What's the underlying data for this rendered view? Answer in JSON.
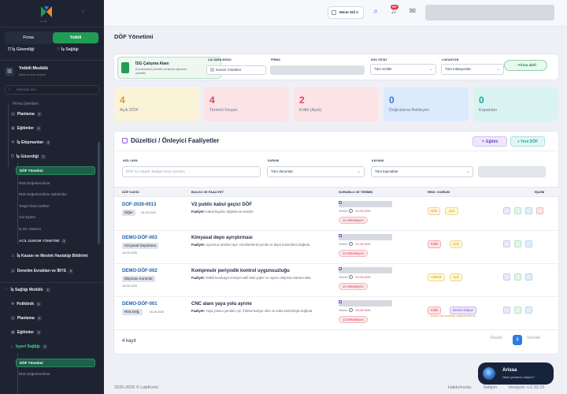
{
  "sidebar": {
    "logo_sub": "by iSG",
    "toggle": {
      "firma": "Firma",
      "yetkili": "Yetkili"
    },
    "switch": {
      "isg": "İş Güvenliği",
      "saglik": "İş Sağlığı"
    },
    "module": {
      "title": "Yetkili Modülü",
      "subtitle": "İşletme hızlı erişimi"
    },
    "search_placeholder": "Menüde ara...",
    "items": [
      {
        "label": "Firma İşlemleri",
        "count": ""
      },
      {
        "label": "Planlama",
        "count": "4"
      },
      {
        "label": "Eğitimler",
        "count": "4"
      },
      {
        "label": "İş Ekipmanları",
        "count": "4"
      },
      {
        "label": "İş Güvenliği",
        "count": "7"
      },
      {
        "label": "DÖF Yönetimi"
      },
      {
        "label": "Risk Değerlendirme"
      },
      {
        "label": "Risk Değerlendirme Şablonları"
      },
      {
        "label": "Tespit Öneri Defteri"
      },
      {
        "label": "Acil Eylem"
      },
      {
        "label": "İş İzin Sistemi"
      },
      {
        "label": "ACİL DURUM YÖNETİMİ",
        "count": "3"
      },
      {
        "label": "İş Kazası ve Meslek Hastalığı Bildirimi",
        "count": ""
      },
      {
        "label": "Denetim Evrakları ve İBYS",
        "count": "3"
      },
      {
        "label": "İş Sağlığı Modülü",
        "count": "4"
      },
      {
        "label": "Poliklinik",
        "count": "4"
      },
      {
        "label": "Planlama",
        "count": "4"
      },
      {
        "label": "Eğitimler",
        "count": "4"
      },
      {
        "label": "İşyeri Sağlığı",
        "count": "4"
      },
      {
        "label": "DÖF Yönetimi"
      },
      {
        "label": "Risk Değerlendirme"
      }
    ]
  },
  "header": {
    "company": "Menü Stil 2",
    "notif_badge": "99+"
  },
  "page": {
    "title": "DÖF Yönetimi"
  },
  "context": {
    "area_title": "İSG Çalışma Alanı",
    "area_desc": "Kurum/şirket yönetim verilerine işlemleri yönelttir",
    "mode_label": "ÇALIŞMA MODU",
    "mode_value": "Kurum Yönetimi",
    "firm_label": "FİRMA",
    "site_label": "SGK SİCİLİ",
    "site_value": "Tüm siciller",
    "loc_label": "LOKASYON",
    "loc_value": "Tüm lokasyonlar",
    "status": "Firma aktif"
  },
  "stats": [
    {
      "value": "4",
      "label": "Açık DÖF",
      "color": "#d4a017",
      "bg": "#fbf3d8"
    },
    {
      "value": "4",
      "label": "Termini Geçen",
      "color": "#e0455a",
      "bg": "#fce3e6"
    },
    {
      "value": "2",
      "label": "Kritik (Açık)",
      "color": "#e0455a",
      "bg": "#fce3e6"
    },
    {
      "value": "0",
      "label": "Doğrulama Bekleyen",
      "color": "#2f7de0",
      "bg": "#dceafc"
    },
    {
      "value": "0",
      "label": "Kapatılan",
      "color": "#1aa79a",
      "bg": "#d9f4f0"
    }
  ],
  "panel": {
    "title": "Düzeltici / Önleyici Faaliyetler",
    "training_btn": "Eğitim",
    "new_btn": "+ Yeni DÖF",
    "search_label": "HIZLI ARA",
    "search_placeholder": "DÖF no, başlık, faaliyet veya sorumlu",
    "status_label": "DURUM",
    "status_value": "Tüm durumlar",
    "source_label": "KAYNAK",
    "source_value": "Tüm kaynaklar",
    "columns": [
      "DÖF KAYDI",
      "BULGU VE FAALİYET",
      "SORUMLU VE TERMİN",
      "RİSK / DURUM",
      "İŞLEM"
    ],
    "rows": [
      {
        "id": "DOF-2026-0013",
        "tag": "Diğer",
        "date": "25.08.2026",
        "title": "V2 public kabul geçici DÖF",
        "act": "Faaliyet:",
        "desc": "Kabul kaydını doğrula ve temizle",
        "term": "Termin",
        "term_date": "13.09.2026",
        "esc": "12 eskalasyon",
        "risk": "Orta",
        "risk_color": "#e08a1e",
        "risk_bg": "#fff3e0",
        "status": "Açık",
        "status_color": "#c99a12",
        "status_bg": "#fff8d6",
        "note": ""
      },
      {
        "id": "DEMO-DÖF-003",
        "tag": "Kimyasal Depolama",
        "date": "18.08.2026",
        "title": "Kimyasal depo ayrıştırması",
        "act": "Faaliyet:",
        "desc": "Uyumsuz ürünleri ayır, raf etiketlerini yenile ve depo kontrolünü doğrula.",
        "term": "Termin",
        "term_date": "21.08.2026",
        "esc": "13 eskalasyon",
        "risk": "Kritik",
        "risk_color": "#d8364a",
        "risk_bg": "#fde6e9",
        "status": "Açık",
        "status_color": "#c99a12",
        "status_bg": "#fff8d6",
        "note": ""
      },
      {
        "id": "DEMO-DÖF-002",
        "tag": "Ekipman Kontrolü",
        "date": "18.08.2026",
        "title": "Kompresör periyodik kontrol uygunsuzluğu",
        "act": "Faaliyet:",
        "desc": "Yetkili kuruluşça emniyet valfi testi yaptır ve raporu ekipman kartına ekle.",
        "term": "Termin",
        "term_date": "25.08.2026",
        "esc": "13 eskalasyon",
        "risk": "Yüksek",
        "risk_color": "#c99a12",
        "risk_bg": "#fff8d6",
        "status": "Açık",
        "status_color": "#c99a12",
        "status_bg": "#fff8d6",
        "note": ""
      },
      {
        "id": "DEMO-DÖF-001",
        "tag": "Risk Değ.",
        "date": "18.08.2026",
        "title": "CNC alanı yaya yolu ayrımı",
        "act": "Faaliyet:",
        "desc": "Yaya yolunu yeniden çiz, fiziksel bariyer ekle ve saha kontrolüyle doğrula.",
        "term": "Termin",
        "term_date": "28.08.2026",
        "esc": "13 eskalasyon",
        "risk": "Kritik",
        "risk_color": "#d8364a",
        "risk_bg": "#fde6e9",
        "status": "Devam Ediyor",
        "status_color": "#7b4fd1",
        "status_bg": "#efe8fc",
        "note": "Geçici risk kontrolü değerlendirme"
      }
    ],
    "count": "4 kayıt",
    "prev": "Önceki",
    "page": "1",
    "next": "Sonraki"
  },
  "footer": {
    "copy": "2020-2026 © LabKonic",
    "help": "Hakkımızda",
    "contact": "İletişim",
    "version": "Versiyon: v.2.33.15"
  },
  "chat": {
    "name": "Arissa",
    "sub": "Nasıl yardımcı olayım?"
  }
}
